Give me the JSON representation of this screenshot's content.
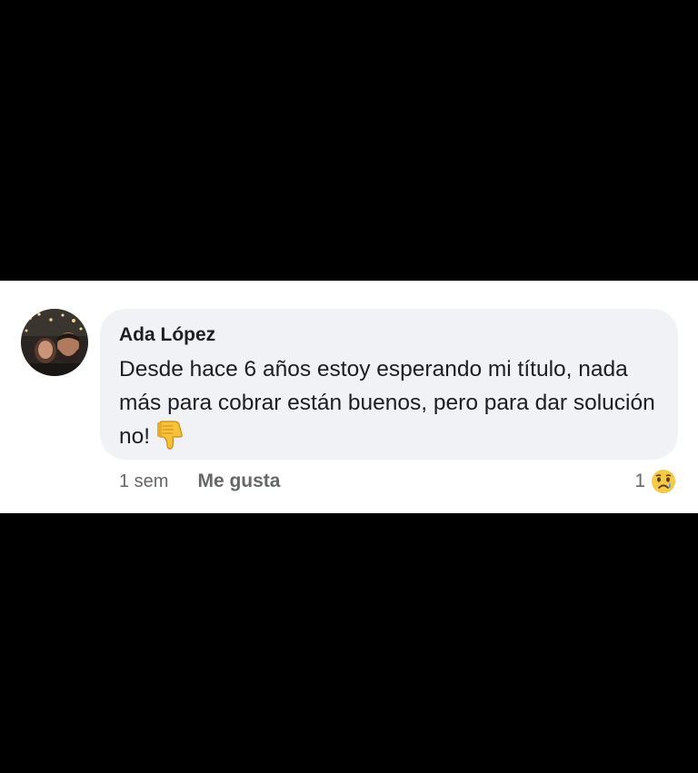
{
  "comment": {
    "author": "Ada López",
    "text": "Desde hace 6 años estoy esperando mi título, nada más para cobrar están buenos, pero para dar solución no!",
    "emoji_icon": "thumbs-down-icon",
    "avatar_icon": "profile-photo-avatar"
  },
  "actions": {
    "timestamp": "1 sem",
    "like_label": "Me gusta"
  },
  "reactions": {
    "count": "1",
    "icon": "sad-crying-face-icon"
  },
  "colors": {
    "bubble_background": "#f0f2f5",
    "text_primary": "#1c1e21",
    "text_secondary": "#65676b",
    "backdrop": "#000000"
  }
}
